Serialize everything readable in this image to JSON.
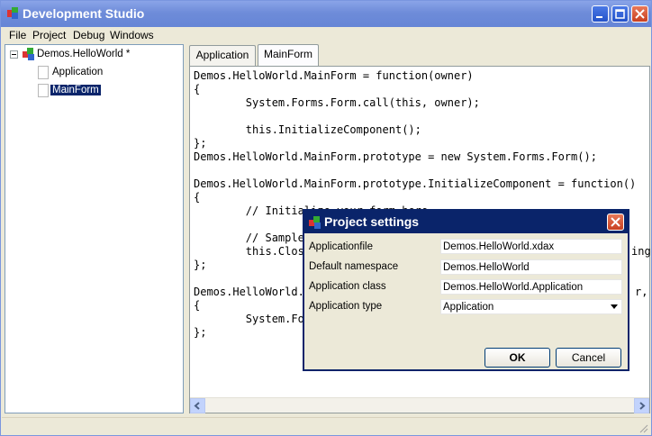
{
  "window": {
    "title": "Development Studio"
  },
  "menu": [
    "File",
    "Project",
    "Debug",
    "Windows"
  ],
  "tree": {
    "root": "Demos.HelloWorld *",
    "children": [
      "Application",
      "MainForm"
    ]
  },
  "tabs": [
    "Application",
    "MainForm"
  ],
  "editor": {
    "lines": [
      "Demos.HelloWorld.MainForm = function(owner)",
      "{",
      "        System.Forms.Form.call(this, owner);",
      "",
      "        this.InitializeComponent();",
      "};",
      "Demos.HelloWorld.MainForm.prototype = new System.Forms.Form();",
      "",
      "Demos.HelloWorld.MainForm.prototype.InitializeComponent = function()",
      "{",
      "        // Initialize your form here",
      "",
      "        // Sample",
      "        this.Clos",
      "};",
      "",
      "Demos.HelloWorld.M",
      "{",
      "        System.For",
      "};"
    ],
    "right_fragment_1": "ing",
    "right_fragment_2": "r,"
  },
  "dialog": {
    "title": "Project settings",
    "fields": [
      {
        "label": "Applicationfile",
        "value": "Demos.HelloWorld.xdax"
      },
      {
        "label": "Default namespace",
        "value": "Demos.HelloWorld"
      },
      {
        "label": "Application class",
        "value": "Demos.HelloWorld.Application"
      },
      {
        "label": "Application type",
        "value": "Application"
      }
    ],
    "ok_label": "OK",
    "cancel_label": "Cancel"
  }
}
